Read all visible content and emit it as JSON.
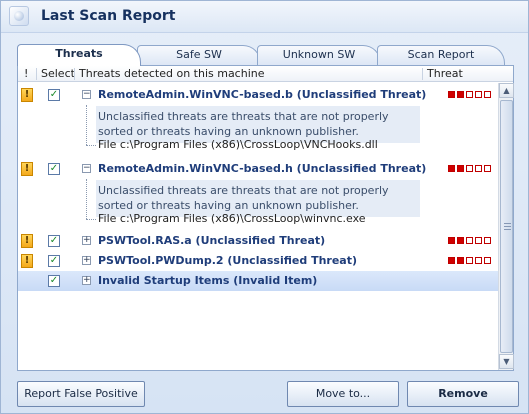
{
  "window": {
    "title": "Last Scan Report",
    "icon": "app-icon"
  },
  "tabs": [
    {
      "label": "Threats",
      "active": true
    },
    {
      "label": "Safe SW",
      "active": false
    },
    {
      "label": "Unknown SW",
      "active": false
    },
    {
      "label": "Scan Report",
      "active": false
    }
  ],
  "columns": {
    "flag": "!",
    "select": "Select",
    "threats": "Threats detected on this machine",
    "threat": "Threat"
  },
  "rows": [
    {
      "flag": "!",
      "checked": "✓",
      "expander": "−",
      "name": "RemoteAdmin.WinVNC-based.b (Unclassified Threat)",
      "level": 2,
      "level_max": 5,
      "description": "Unclassified  threats are threats that are not properly sorted or threats having an unknown publisher.",
      "file": "File c:\\Program Files (x86)\\CrossLoop\\VNCHooks.dll"
    },
    {
      "flag": "!",
      "checked": "✓",
      "expander": "−",
      "name": "RemoteAdmin.WinVNC-based.h (Unclassified Threat)",
      "level": 2,
      "level_max": 5,
      "description": "Unclassified  threats are threats that are not properly sorted or threats having an unknown publisher.",
      "file": "File c:\\Program Files (x86)\\CrossLoop\\winvnc.exe"
    },
    {
      "flag": "!",
      "checked": "✓",
      "expander": "+",
      "name": "PSWTool.RAS.a (Unclassified Threat)",
      "level": 2,
      "level_max": 5
    },
    {
      "flag": "!",
      "checked": "✓",
      "expander": "+",
      "name": "PSWTool.PWDump.2 (Unclassified Threat)",
      "level": 2,
      "level_max": 5
    },
    {
      "flag": "",
      "checked": "✓",
      "expander": "+",
      "name": "Invalid Startup Items (Invalid Item)",
      "selected": true
    }
  ],
  "buttons": {
    "report_false_positive": "Report False Positive",
    "move_to": "Move to...",
    "remove": "Remove"
  },
  "colors": {
    "accent": "#1f3d7a",
    "threat_on": "#d00000",
    "selection": "#c8daf6"
  }
}
